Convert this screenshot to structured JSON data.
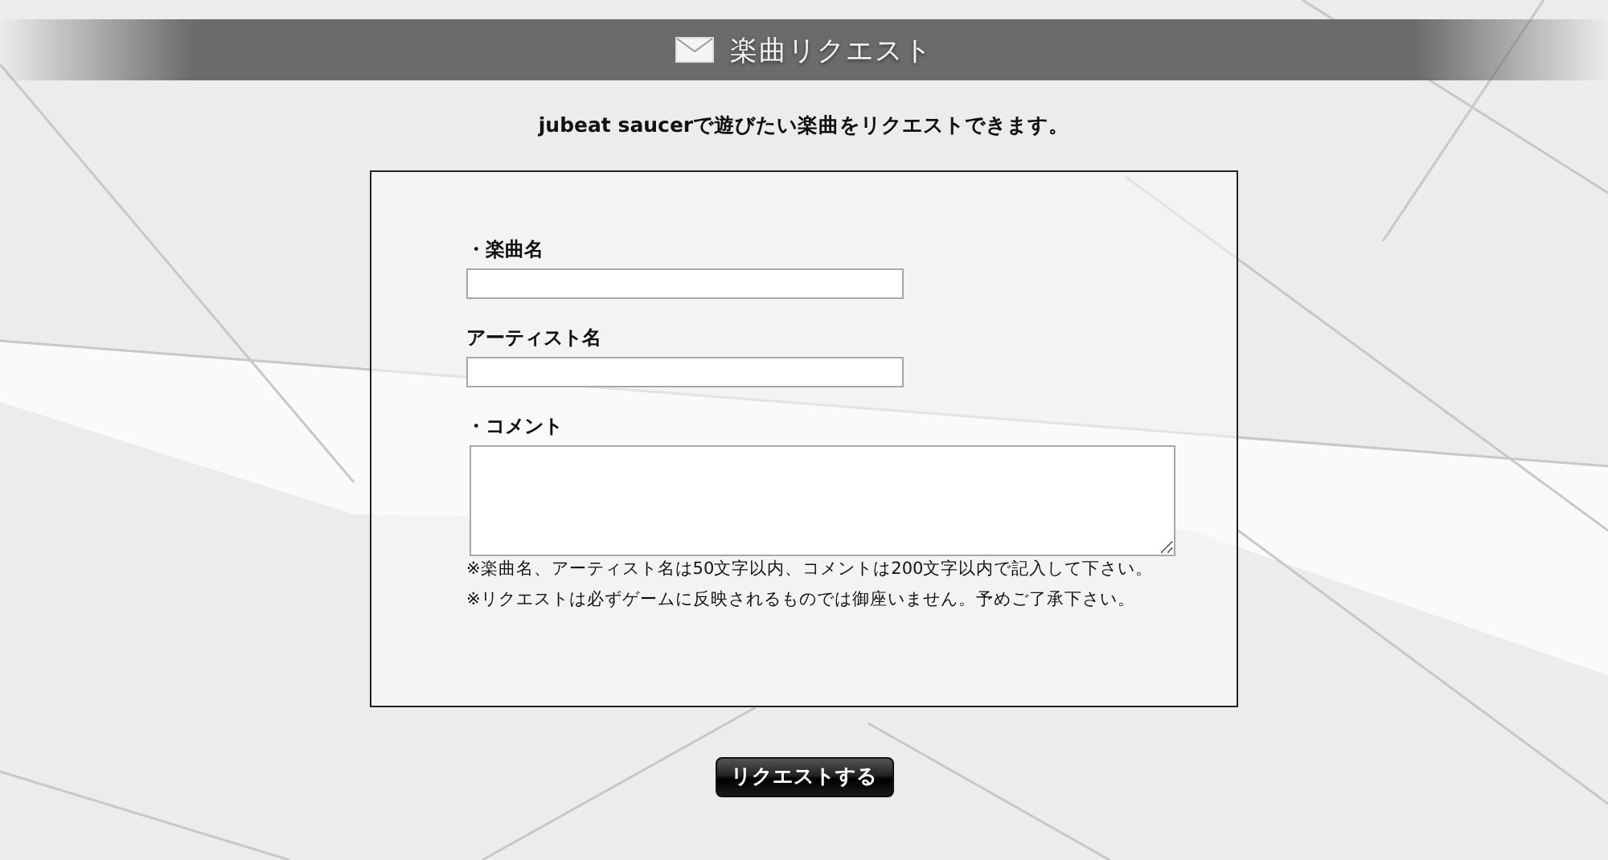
{
  "header": {
    "title": "楽曲リクエスト"
  },
  "intro": "jubeat saucerで遊びたい楽曲をリクエストできます。",
  "form": {
    "fields": [
      {
        "kind": "input",
        "label": "・楽曲名"
      },
      {
        "kind": "input",
        "label": "アーティスト名"
      },
      {
        "kind": "textarea",
        "label": "・コメント"
      }
    ],
    "notes": [
      "※楽曲名、アーティスト名は50文字以内、コメントは200文字以内で記入して下さい。",
      "※リクエストは必ずゲームに反映されるものでは御座いません。予めご了承下さい。"
    ]
  },
  "submit": "リクエストする"
}
